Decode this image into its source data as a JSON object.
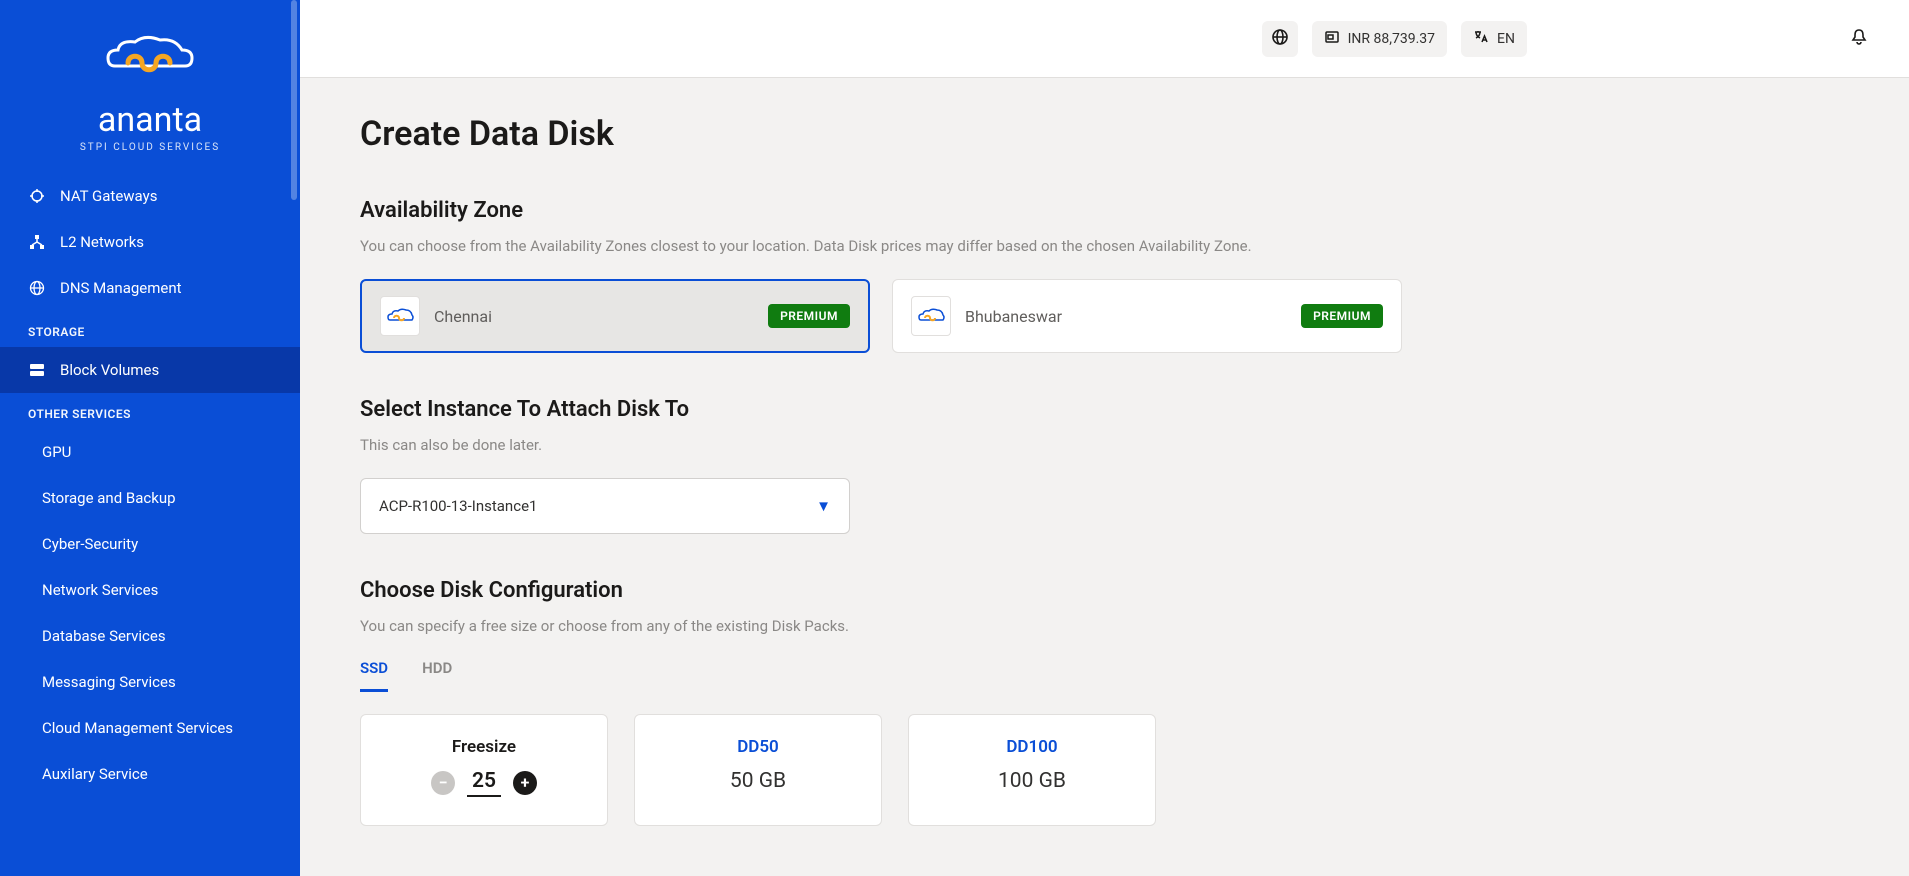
{
  "brand": {
    "name": "ananta",
    "subtitle": "STPI CLOUD SERVICES"
  },
  "sidebar": {
    "items_top": [
      {
        "label": "NAT Gateways"
      },
      {
        "label": "L2 Networks"
      },
      {
        "label": "DNS Management"
      }
    ],
    "section_storage": "STORAGE",
    "storage_items": [
      {
        "label": "Block Volumes"
      }
    ],
    "section_other": "OTHER SERVICES",
    "other_items": [
      {
        "label": "GPU"
      },
      {
        "label": "Storage and Backup"
      },
      {
        "label": "Cyber-Security"
      },
      {
        "label": "Network Services"
      },
      {
        "label": "Database Services"
      },
      {
        "label": "Messaging Services"
      },
      {
        "label": "Cloud Management Services"
      },
      {
        "label": "Auxilary Service"
      }
    ]
  },
  "topbar": {
    "balance": "INR 88,739.37",
    "language": "EN"
  },
  "page": {
    "title": "Create Data Disk",
    "zone": {
      "title": "Availability Zone",
      "desc": "You can choose from the Availability Zones closest to your location. Data Disk prices may differ based on the chosen Availability Zone.",
      "options": [
        {
          "name": "Chennai",
          "badge": "PREMIUM",
          "selected": true
        },
        {
          "name": "Bhubaneswar",
          "badge": "PREMIUM",
          "selected": false
        }
      ]
    },
    "instance": {
      "title": "Select Instance To Attach Disk To",
      "desc": "This can also be done later.",
      "selected": "ACP-R100-13-Instance1"
    },
    "config": {
      "title": "Choose Disk Configuration",
      "desc": "You can specify a free size or choose from any of the existing Disk Packs.",
      "tabs": [
        {
          "label": "SSD",
          "active": true
        },
        {
          "label": "HDD",
          "active": false
        }
      ],
      "freesize": {
        "label": "Freesize",
        "value": "25"
      },
      "packs": [
        {
          "name": "DD50",
          "size": "50 GB"
        },
        {
          "name": "DD100",
          "size": "100 GB"
        }
      ]
    }
  }
}
